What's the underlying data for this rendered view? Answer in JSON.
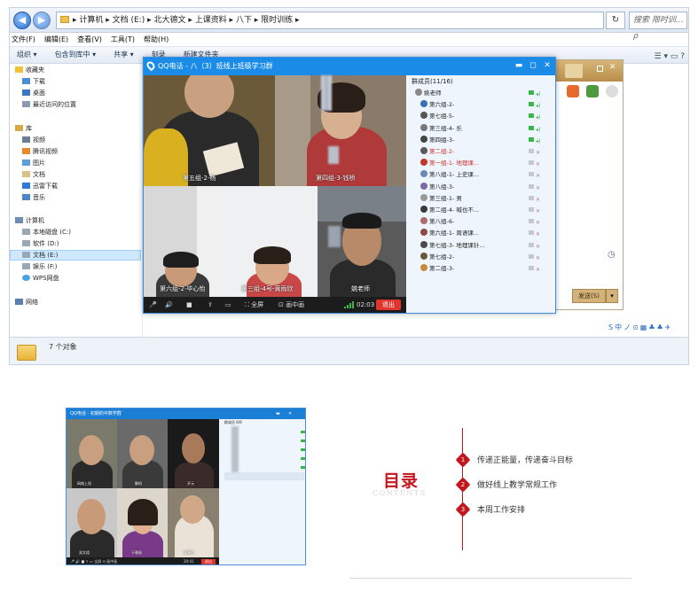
{
  "explorer": {
    "nav_back": "◀",
    "nav_forward": "▶",
    "address_path": "▸ 计算机 ▸ 文档 (E:) ▸ 北大德文 ▸ 上课资料 ▸ 八下 ▸ 限时训练 ▸",
    "refresh": "↻",
    "search_placeholder": "搜索 限时训... ρ",
    "menu": [
      "文件(F)",
      "编辑(E)",
      "查看(V)",
      "工具(T)",
      "帮助(H)"
    ],
    "toolbar": [
      "组织 ▾",
      "包含到库中 ▾",
      "共享 ▾",
      "刻录",
      "新建文件夹"
    ],
    "toolbar_right": "☰ ▾  ▭  ?",
    "nav": {
      "favorites": "收藏夹",
      "download": "下载",
      "desktop": "桌面",
      "recent": "最近访问的位置",
      "library": "库",
      "video": "视频",
      "tencent_video": "腾讯视频",
      "pictures": "图片",
      "documents": "文档",
      "xunlei": "迅雷下载",
      "music": "音乐",
      "computer": "计算机",
      "drive_c": "本地磁盘 (C:)",
      "drive_d": "软件 (D:)",
      "drive_e": "文档 (E:)",
      "drive_f": "娱乐 (F:)",
      "wps": "WPS网盘",
      "network": "网络"
    },
    "status": "7 个对象",
    "ime_bar": "S中ノ⊙▦♣♣✈"
  },
  "qqback": {
    "send": "发送(S)",
    "arrow": "▾",
    "clock": "◷"
  },
  "qq_call": {
    "title": "QQ电话 - 八（3）班线上班级学习群",
    "min": "▬",
    "max": "◻",
    "close": "✕",
    "tiles": [
      "第五组-2-杨",
      "第四组-3-钱桥",
      "第六组-2-毕心怡",
      "第三组-4号-黄雨欣",
      "姚老师"
    ],
    "controls": {
      "mic": "🎤",
      "speaker": "🔊",
      "camera": "■",
      "share": "⇪",
      "screen": "▭",
      "fullscreen": "⛶ 全屏",
      "pip": "⊡ 画中画",
      "time": "02:03",
      "exit": "退出"
    },
    "members_title": "群成员(11/16)",
    "members": [
      {
        "name": "姚老师",
        "color": "#222",
        "av": "#888"
      },
      {
        "name": "第六组-2-",
        "color": "#222",
        "av": "#3a6db8"
      },
      {
        "name": "第七组-5-",
        "color": "#222",
        "av": "#555"
      },
      {
        "name": "第三组-4-       乐",
        "color": "#222",
        "av": "#777"
      },
      {
        "name": "第四组-3-",
        "color": "#222",
        "av": "#444"
      },
      {
        "name": "第二组-2-",
        "color": "#d0312d",
        "av": "#5a5a5a"
      },
      {
        "name": "第一组-1-       地理课...",
        "color": "#d0312d",
        "av": "#c0392b"
      },
      {
        "name": "第八组-1-       上史课...",
        "color": "#222",
        "av": "#6a8bb5"
      },
      {
        "name": "第八组-3-",
        "color": "#222",
        "av": "#7a6aa8"
      },
      {
        "name": "第三组-1-       男",
        "color": "#222",
        "av": "#999"
      },
      {
        "name": "第二组-4-       喊也不...",
        "color": "#222",
        "av": "#3a3a3a"
      },
      {
        "name": "第八组-6-",
        "color": "#222",
        "av": "#b06a6a"
      },
      {
        "name": "第六组-1-       周语课...",
        "color": "#222",
        "av": "#8a4a4a"
      },
      {
        "name": "第七组-3-       地理课针...",
        "color": "#222",
        "av": "#4a4a4a"
      },
      {
        "name": "第七组-2-",
        "color": "#222",
        "av": "#6a5a3a"
      },
      {
        "name": "第二组-3-",
        "color": "#222",
        "av": "#c88a3a"
      }
    ]
  },
  "qq_small": {
    "title": "QQ电话 - 初期的中数学群",
    "members_title": "群成员 6/9",
    "tiles": [
      "网络上班",
      "鄱阳",
      "开元",
      "双文组",
      "于雅丽",
      "姚琴红"
    ],
    "controls": "🎤 🔊 ■ ⇪ ▭ 全屏  ⊡ 画中画",
    "time": "20:41",
    "exit": "退出"
  },
  "toc": {
    "title_zh": "目录",
    "title_en": "CONTENTS",
    "items": [
      {
        "num": "1",
        "text": "传递正能量，传递奋斗目标"
      },
      {
        "num": "2",
        "text": "做好线上教学常规工作"
      },
      {
        "num": "3",
        "text": "本周工作安排"
      }
    ],
    "accent": "#c3161e"
  }
}
